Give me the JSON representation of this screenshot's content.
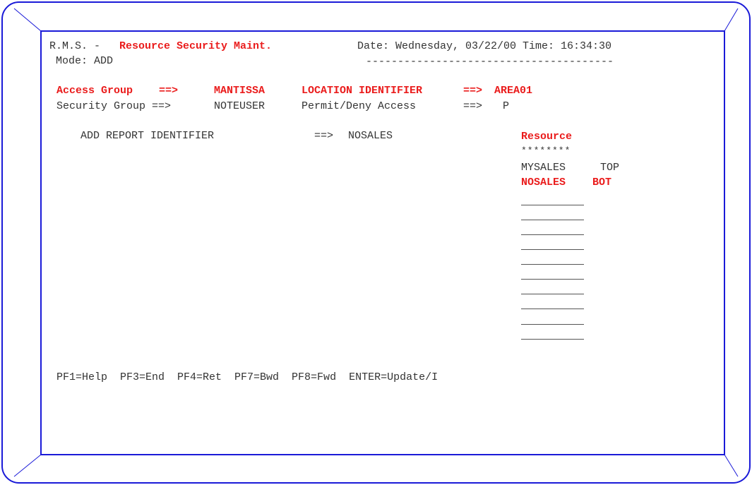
{
  "header": {
    "app_prefix": "R.M.S. - ",
    "title": "Resource Security Maint.",
    "date_time": "Date: Wednesday, 03/22/00 Time: 16:34:30",
    "mode": "Mode: ADD",
    "rule": "---------------------------------------"
  },
  "fields": {
    "access_group_label": "Access Group",
    "access_group_arrow": "==>",
    "access_group_value": "MANTISSA",
    "location_label": "LOCATION IDENTIFIER",
    "location_arrow": "==>",
    "location_value": "AREA01",
    "security_group_label": "Security Group ==>",
    "security_group_value": "NOTEUSER",
    "permit_label": "Permit/Deny Access",
    "permit_arrow": "==>",
    "permit_value": "P",
    "add_report_label": "ADD REPORT IDENTIFIER",
    "add_report_arrow": "==>",
    "add_report_value": "NOSALES"
  },
  "resource_list": {
    "header": "Resource",
    "mask": "********",
    "rows": [
      {
        "name": "MYSALES",
        "position": "TOP"
      },
      {
        "name": "NOSALES",
        "position": "BOT"
      }
    ],
    "blank_slots": 9
  },
  "footer": {
    "pf_keys": "PF1=Help  PF3=End  PF4=Ret  PF7=Bwd  PF8=Fwd  ENTER=Update/I"
  },
  "colors": {
    "frame_blue": "#1a1ad8",
    "highlight_red": "#ea1c1c",
    "text_gray": "#333333"
  }
}
